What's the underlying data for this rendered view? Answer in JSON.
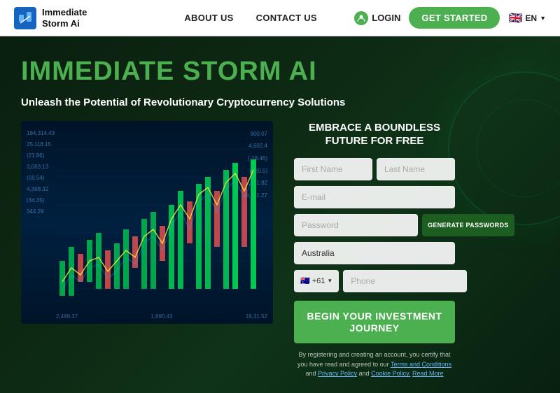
{
  "header": {
    "logo_line1": "Immediate",
    "logo_line2": "Storm Ai",
    "logo_icon_text": "IS",
    "nav_items": [
      {
        "label": "ABOUT US",
        "id": "about-us"
      },
      {
        "label": "CONTACT US",
        "id": "contact-us"
      }
    ],
    "login_label": "LOGIN",
    "get_started_label": "GET STARTED",
    "lang_label": "EN"
  },
  "hero": {
    "title": "IMMEDIATE STORM AI",
    "subtitle": "Unleash the Potential of Revolutionary Cryptocurrency Solutions",
    "form": {
      "panel_title": "EMBRACE A BOUNDLESS FUTURE FOR FREE",
      "first_name_placeholder": "First Name",
      "last_name_placeholder": "Last Name",
      "email_placeholder": "E-mail",
      "password_placeholder": "Password",
      "generate_password_label": "GENERATE PASSWORDS",
      "country_value": "Australia",
      "country_code": "+61",
      "phone_placeholder": "Phone",
      "begin_btn_label": "BEGIN YOUR INVESTMENT JOURNEY",
      "disclaimer_text": "By registering and creating an account, you certify that you have read and agreed to our ",
      "terms_label": "Terms and Conditions",
      "disclaimer_and": " and ",
      "privacy_label": "Privacy Policy",
      "disclaimer_and2": " and ",
      "cookie_label": "Cookie Policy.",
      "read_more_label": "Read More"
    }
  }
}
